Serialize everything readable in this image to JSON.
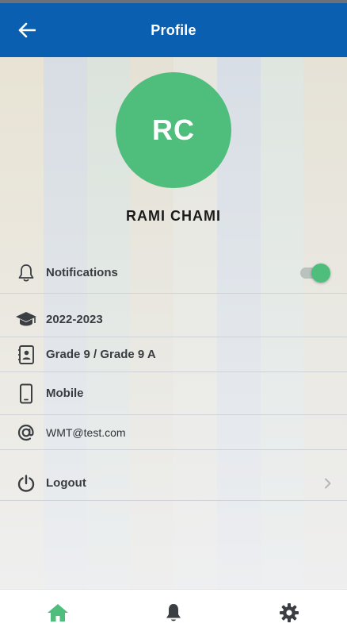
{
  "header": {
    "title": "Profile"
  },
  "profile": {
    "initials": "RC",
    "name": "RAMI CHAMI"
  },
  "menu": {
    "notifications": {
      "label": "Notifications",
      "enabled": true
    },
    "year": {
      "label": "2022-2023"
    },
    "grade": {
      "label": "Grade 9 / Grade 9 A"
    },
    "mobile": {
      "label": "Mobile"
    },
    "email": {
      "label": "WMT@test.com"
    },
    "logout": {
      "label": "Logout"
    }
  },
  "bottom_nav": {
    "items": [
      {
        "name": "home",
        "icon": "home-icon",
        "active": true
      },
      {
        "name": "notifications",
        "icon": "bell-icon",
        "active": false
      },
      {
        "name": "settings",
        "icon": "gear-icon",
        "active": false
      }
    ]
  },
  "colors": {
    "app_bar": "#0a5fb1",
    "accent": "#4fbd7b",
    "icon_inactive": "#3b3f43"
  }
}
